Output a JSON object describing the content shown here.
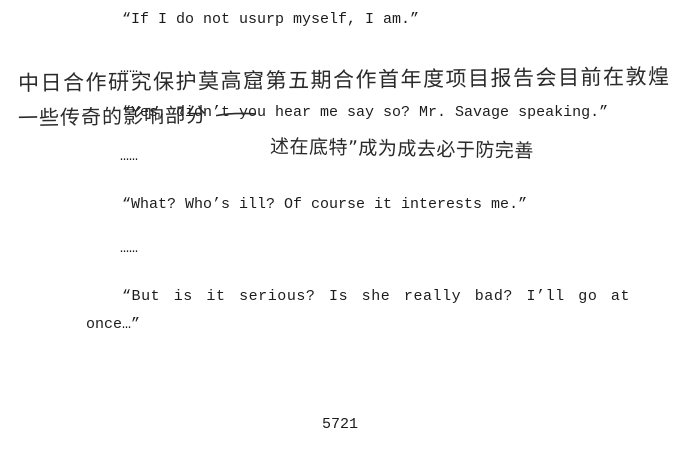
{
  "body": {
    "lines": [
      "“If I do not usurp myself, I am.”",
      "……",
      "“Yes, didn’t you hear me say so? Mr. Savage speaking.”",
      "……",
      "“What? Who’s ill? Of course it interests me.”",
      "……",
      "“But is it serious? Is she really bad? I’ll go at",
      "once…”"
    ],
    "page_number": "5721"
  },
  "handwriting": {
    "line1": "中日合作研究保护莫高窟第五期合作首年度项目报告会目前在敦煌",
    "line2": "一些传奇的影响部分",
    "line3": "述在底特”成为成去必于防完善"
  }
}
